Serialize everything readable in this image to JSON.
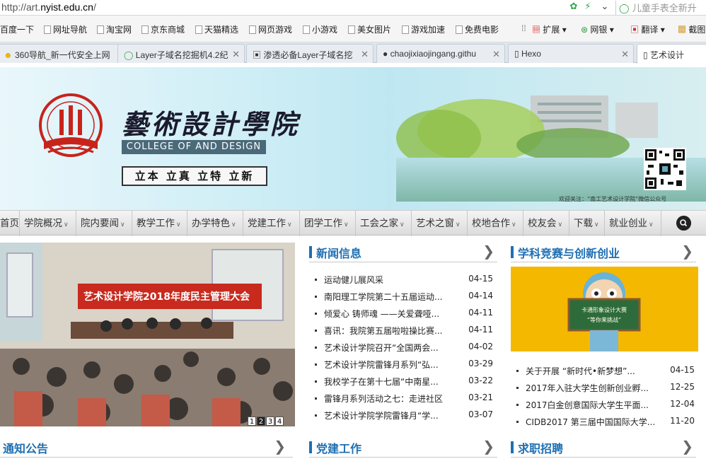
{
  "browser": {
    "url_prefix": "http://art.",
    "url_host": "nyist.edu.cn",
    "url_suffix": "/",
    "search_placeholder": "儿童手表全新升",
    "bookmarks": [
      "百度一下",
      "网址导航",
      "淘宝网",
      "京东商城",
      "天猫精选",
      "网页游戏",
      "小游戏",
      "美女图片",
      "游戏加速",
      "免费电影"
    ],
    "tools": [
      "扩展",
      "网银",
      "翻译",
      "截图"
    ],
    "tabs": [
      {
        "label": "360导航_新一代安全上网"
      },
      {
        "label": "Layer子域名挖掘机4.2纪"
      },
      {
        "label": "渗透必备Layer子域名挖"
      },
      {
        "label": "chaojixiaojingang.githu"
      },
      {
        "label": "Hexo"
      },
      {
        "label": "艺术设计"
      }
    ]
  },
  "header": {
    "title": "藝術設計學院",
    "english": "COLLEGE OF AND DESIGN",
    "motto": "立本 立真 立特 立新",
    "qr_caption": "欢迎关注：“南工艺术设计学院”微信公众号",
    "logo_ring_text": "NANYANG INSTITUTE OF TECHNOLOGY"
  },
  "nav": [
    "首页",
    "学院概况",
    "院内要闻",
    "教学工作",
    "办学特色",
    "党建工作",
    "团学工作",
    "工会之家",
    "艺术之窗",
    "校地合作",
    "校友会",
    "下载",
    "就业创业"
  ],
  "slider": {
    "caption": "艺术设计学院2018年度民主管理大会",
    "pages": [
      "1",
      "2",
      "3",
      "4"
    ],
    "active_page": 1
  },
  "news": {
    "title": "新闻信息",
    "more": "❯",
    "items": [
      {
        "t": "运动健儿展风采",
        "d": "04-15"
      },
      {
        "t": "南阳理工学院第二十五届运动...",
        "d": "04-14"
      },
      {
        "t": "倾爱心 铸师魂 ——关爱聋哑...",
        "d": "04-11"
      },
      {
        "t": "喜讯：我院第五届啦啦操比赛...",
        "d": "04-11"
      },
      {
        "t": "艺术设计学院召开“全国两会...",
        "d": "04-02"
      },
      {
        "t": "艺术设计学院雷锋月系列“弘...",
        "d": "03-29"
      },
      {
        "t": "我校学子在第十七届“中南星...",
        "d": "03-22"
      },
      {
        "t": "雷锋月系列活动之七：走进社区",
        "d": "03-21"
      },
      {
        "t": "艺术设计学院学院雷锋月“学...",
        "d": "03-07"
      }
    ]
  },
  "contest": {
    "title": "学科竞赛与创新创业",
    "more": "❯",
    "board_line1": "卡通形象设计大赛",
    "board_line2": "“等你来挑战”",
    "items": [
      {
        "t": "关于开展 “新时代•新梦想”...",
        "d": "04-15"
      },
      {
        "t": "2017年入驻大学生创新创业孵...",
        "d": "12-25"
      },
      {
        "t": "2017白金创意国际大学生平面...",
        "d": "12-04"
      },
      {
        "t": "CIDB2017 第三届中国国际大学...",
        "d": "11-20"
      }
    ]
  },
  "bottom_sections": [
    {
      "title": "通知公告",
      "more": "❯"
    },
    {
      "title": "党建工作",
      "more": "❯"
    },
    {
      "title": "求职招聘",
      "more": "❯"
    }
  ],
  "colors": {
    "accent": "#1f6fb3",
    "nav_bg": "#dcdcdc",
    "contest_bg": "#f5b800"
  }
}
